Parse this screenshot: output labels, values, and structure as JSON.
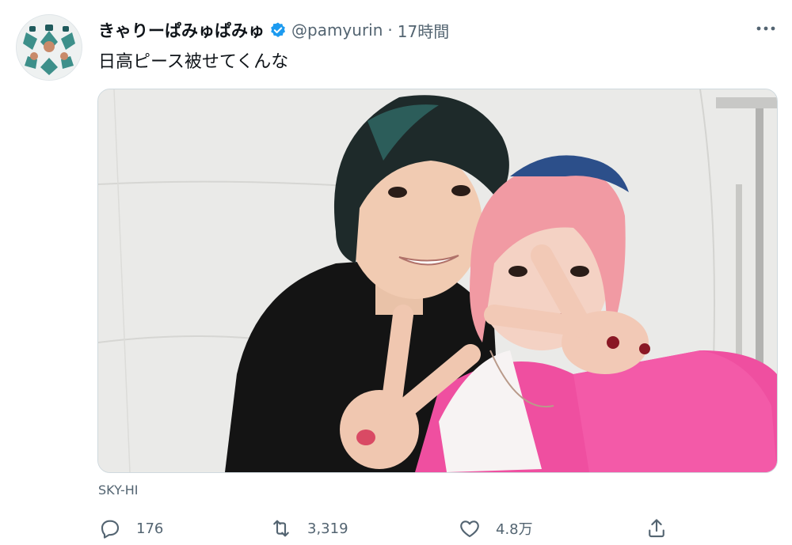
{
  "tweet": {
    "display_name": "きゃりーぱみゅぱみゅ",
    "handle": "@pamyurin",
    "separator": "·",
    "time": "17時間",
    "text": "日高ピース被せてくんな",
    "media_caption": "SKY-HI",
    "verified": true
  },
  "actions": {
    "replies": "176",
    "retweets": "3,319",
    "likes": "4.8万"
  },
  "icons": {
    "avatar": "avatar-image",
    "verified": "verified-badge-icon",
    "more": "more-options-icon",
    "reply": "reply-icon",
    "retweet": "retweet-icon",
    "like": "heart-icon",
    "share": "share-icon"
  },
  "colors": {
    "verified": "#1d9bf0",
    "secondary_text": "#536471",
    "primary_text": "#0f1419"
  }
}
